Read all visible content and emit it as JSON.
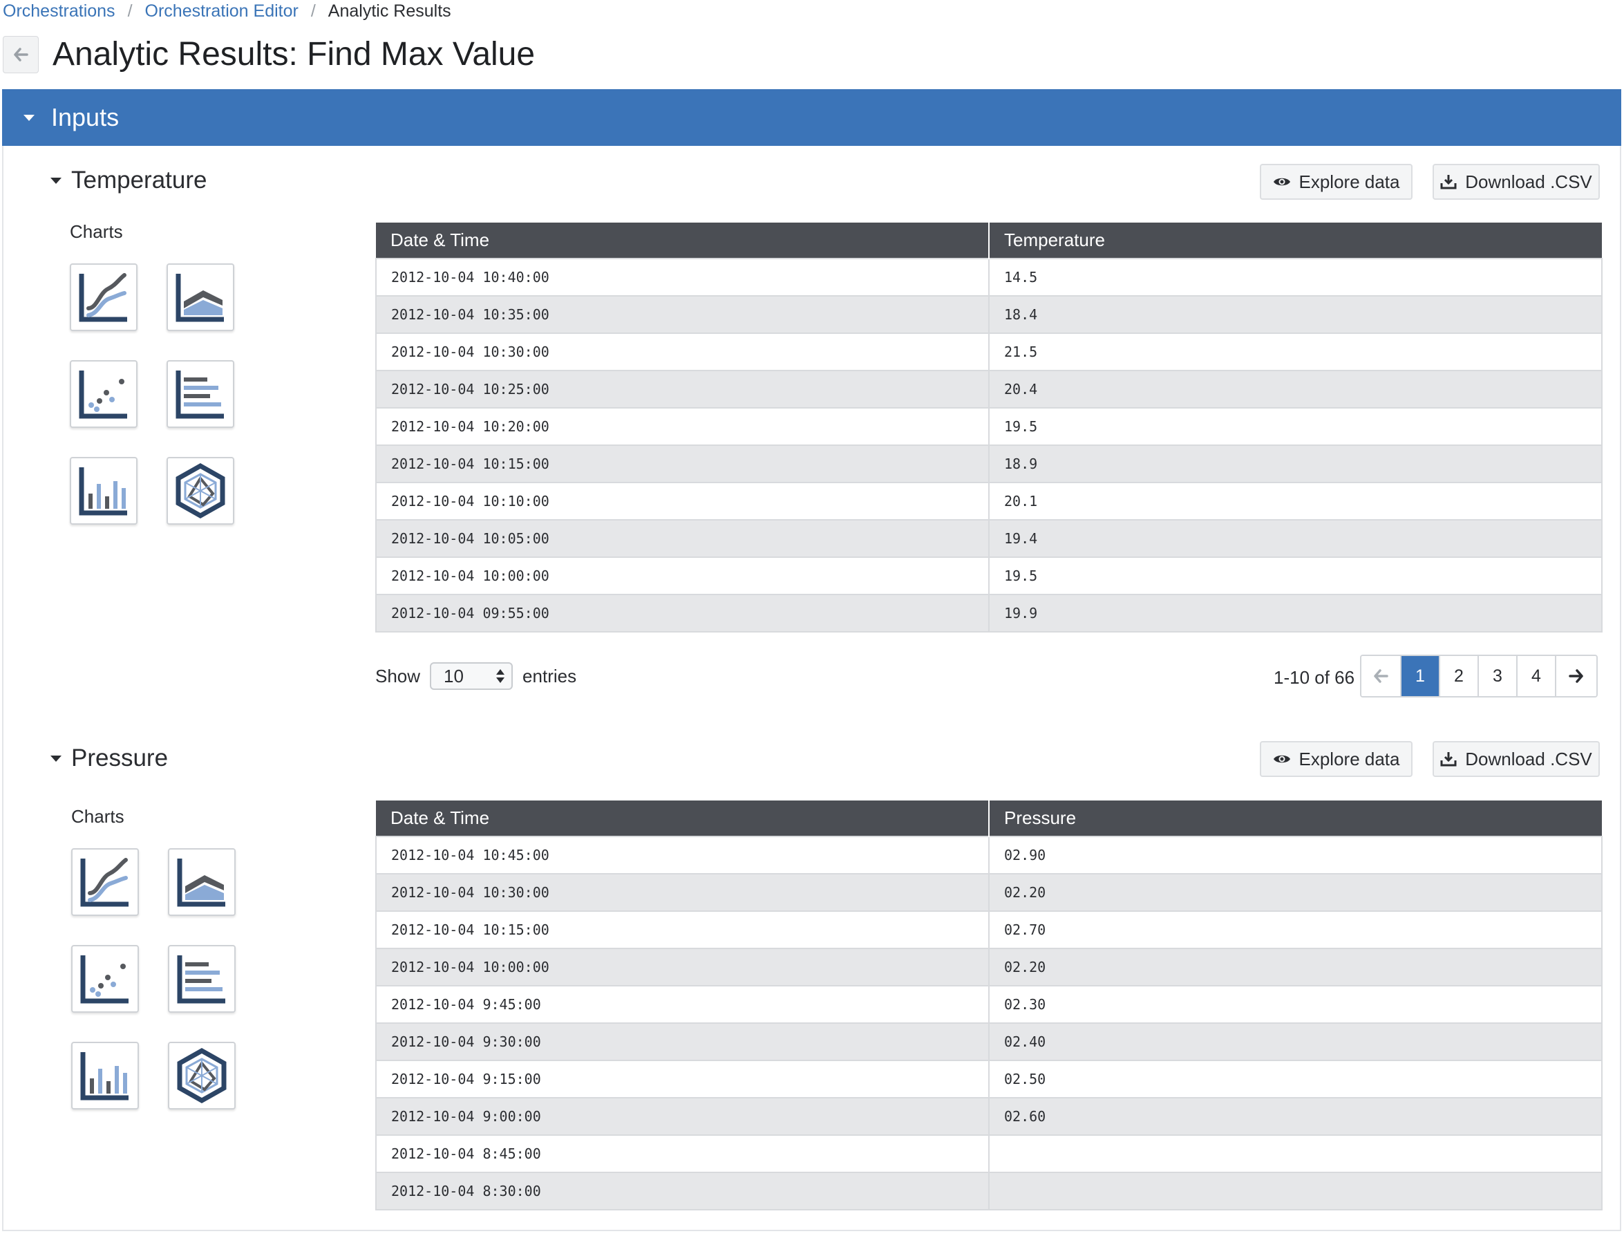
{
  "breadcrumb": {
    "items": [
      "Orchestrations",
      "Orchestration Editor"
    ],
    "current": "Analytic Results",
    "separator": "/"
  },
  "page": {
    "title": "Analytic Results: Find Max Value"
  },
  "inputs": {
    "label": "Inputs"
  },
  "colors": {
    "accent": "#3b74b8",
    "table_header": "#4b4e54",
    "chart_dark": "#2c4566",
    "chart_light": "#8aaad6",
    "chart_grey": "#56595e"
  },
  "temperature": {
    "title": "Temperature",
    "explore_label": "Explore data",
    "download_label": "Download .CSV",
    "charts_label": "Charts",
    "columns": [
      "Date & Time",
      "Temperature"
    ],
    "rows": [
      [
        "2012-10-04 10:40:00",
        "14.5"
      ],
      [
        "2012-10-04 10:35:00",
        "18.4"
      ],
      [
        "2012-10-04 10:30:00",
        "21.5"
      ],
      [
        "2012-10-04 10:25:00",
        "20.4"
      ],
      [
        "2012-10-04 10:20:00",
        "19.5"
      ],
      [
        "2012-10-04 10:15:00",
        "18.9"
      ],
      [
        "2012-10-04 10:10:00",
        "20.1"
      ],
      [
        "2012-10-04 10:05:00",
        "19.4"
      ],
      [
        "2012-10-04 10:00:00",
        "19.5"
      ],
      [
        "2012-10-04 09:55:00",
        "19.9"
      ]
    ],
    "show_label": "Show",
    "entries_value": "10",
    "entries_label": "entries",
    "range_text": "1-10 of 66",
    "pages": [
      "1",
      "2",
      "3",
      "4"
    ],
    "active_page": "1"
  },
  "pressure": {
    "title": "Pressure",
    "explore_label": "Explore data",
    "download_label": "Download .CSV",
    "charts_label": "Charts",
    "columns": [
      "Date & Time",
      "Pressure"
    ],
    "rows": [
      [
        "2012-10-04 10:45:00",
        "02.90"
      ],
      [
        "2012-10-04 10:30:00",
        "02.20"
      ],
      [
        "2012-10-04 10:15:00",
        "02.70"
      ],
      [
        "2012-10-04 10:00:00",
        "02.20"
      ],
      [
        "2012-10-04 9:45:00",
        "02.30"
      ],
      [
        "2012-10-04 9:30:00",
        "02.40"
      ],
      [
        "2012-10-04 9:15:00",
        "02.50"
      ],
      [
        "2012-10-04 9:00:00",
        "02.60"
      ],
      [
        "2012-10-04 8:45:00",
        ""
      ],
      [
        "2012-10-04 8:30:00",
        ""
      ]
    ]
  },
  "chart_icons": [
    "line-chart-icon",
    "area-chart-icon",
    "scatter-chart-icon",
    "horizontal-bar-chart-icon",
    "bar-chart-icon",
    "radar-chart-icon"
  ]
}
